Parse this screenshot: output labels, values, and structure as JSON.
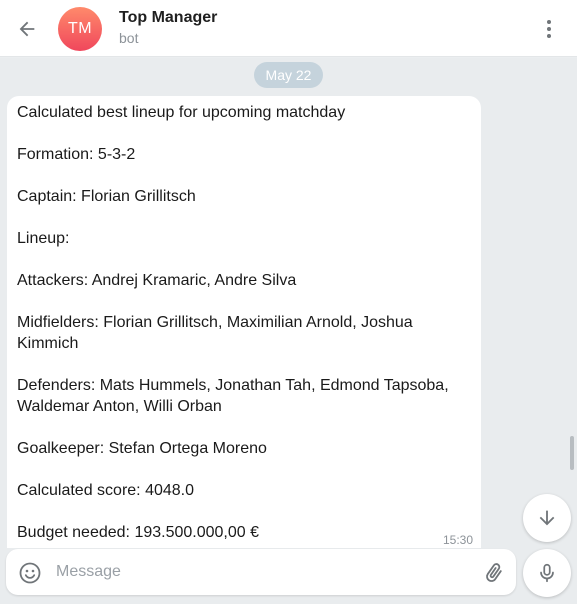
{
  "header": {
    "avatar_initials": "TM",
    "title": "Top Manager",
    "subtitle": "bot",
    "back_icon": "arrow-left-icon",
    "menu_icon": "more-vertical-icon"
  },
  "chat": {
    "date_label": "May 22",
    "message": {
      "lines": [
        "Calculated best lineup for upcoming matchday",
        "Formation:  5-3-2",
        "Captain:  Florian Grillitsch",
        "Lineup:",
        "Attackers:  Andrej Kramaric, Andre Silva",
        "Midfielders: Florian Grillitsch, Maximilian Arnold, Joshua",
        "Kimmich",
        "Defenders:  Mats Hummels, Jonathan Tah, Edmond Tapsoba,",
        "Waldemar Anton, Willi Orban",
        "Goalkeeper:  Stefan Ortega Moreno",
        "Calculated score: 4048.0",
        "Budget needed:  193.500.000,00 €"
      ],
      "time": "15:30"
    }
  },
  "composer": {
    "placeholder": "Message",
    "emoji_icon": "smile-icon",
    "attach_icon": "paperclip-icon"
  },
  "buttons": {
    "scroll_down_icon": "arrow-down-icon",
    "mic_icon": "microphone-icon"
  },
  "colors": {
    "accent": "#f0475c",
    "chat_background": "#e9ecee",
    "date_pill": "#c5d3dc"
  }
}
